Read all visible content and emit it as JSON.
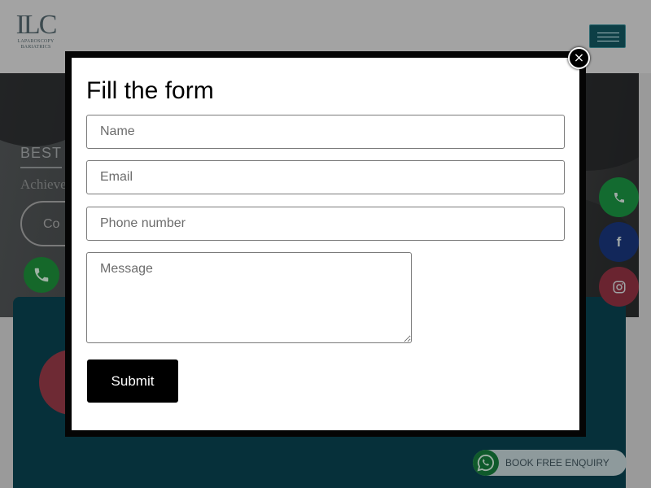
{
  "site": {
    "logo_mark": "ILC",
    "logo_line1": "LAPAROSCOPY",
    "logo_line2": "BARIATRICS",
    "hero_kicker": "BEST",
    "hero_tagline": "Achieve",
    "hero_cta": "Co"
  },
  "modal": {
    "title": "Fill the form",
    "fields": {
      "name_placeholder": "Name",
      "email_placeholder": "Email",
      "phone_placeholder": "Phone number",
      "message_placeholder": "Message"
    },
    "submit_label": "Submit",
    "close_symbol": "×"
  },
  "floating": {
    "facebook_glyph": "f",
    "enquiry_label": "BOOK FREE ENQUIRY"
  },
  "icons": [
    "menu-icon",
    "phone-icon",
    "facebook-icon",
    "instagram-icon",
    "whatsapp-icon",
    "close-icon"
  ],
  "colors": {
    "brand_teal": "#0d3f46",
    "whatsapp_green": "#25d366",
    "submit_bg": "#000000"
  }
}
